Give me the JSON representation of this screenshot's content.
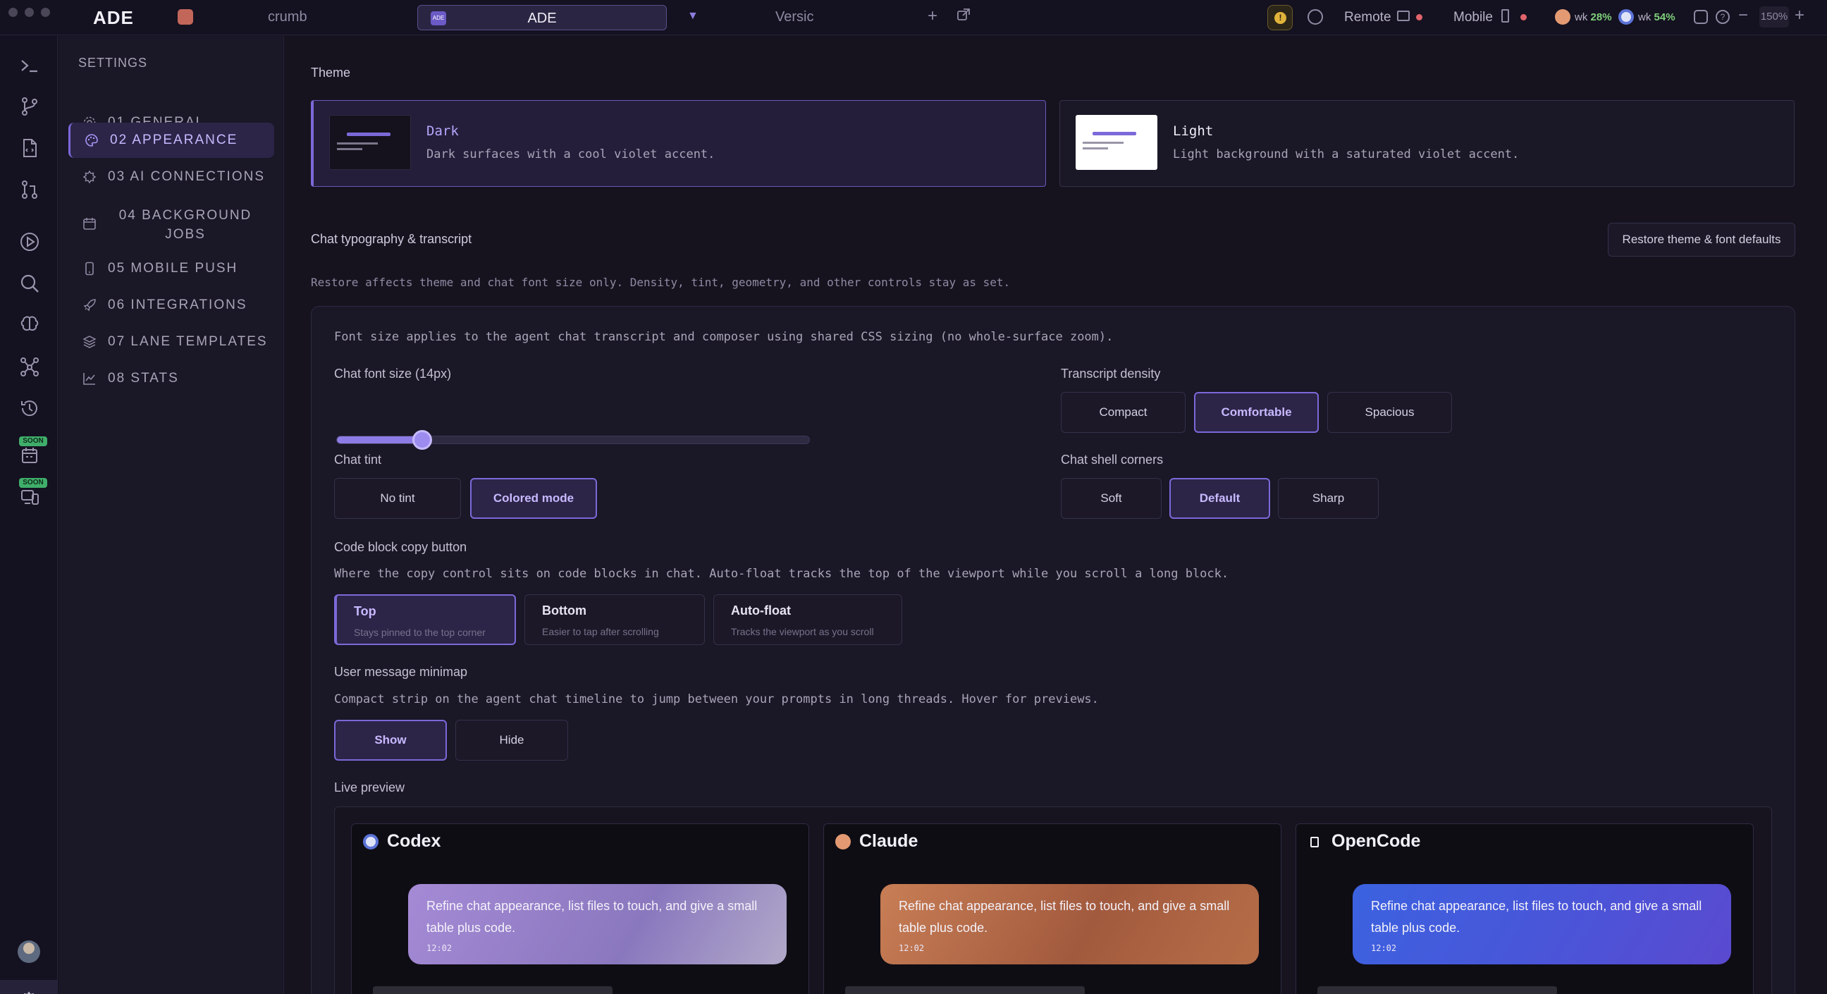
{
  "titlebar": {
    "brand": "ADE",
    "tabs": [
      {
        "label": "crumb"
      },
      {
        "label": "ADE",
        "icon_text": "ADE",
        "active": true
      },
      {
        "label": "Versic"
      }
    ],
    "new_tab": "+",
    "remote_label": "Remote",
    "mobile_label": "Mobile",
    "usage": [
      {
        "prefix": "wk",
        "value": "28%"
      },
      {
        "prefix": "wk",
        "value": "54%"
      }
    ],
    "zoom_minus": "−",
    "zoom": "150%",
    "zoom_plus": "+"
  },
  "rail": {
    "icons": [
      "terminal-icon",
      "branch-icon",
      "files-icon",
      "pull-request-icon",
      "run-icon",
      "search-icon",
      "brain-icon",
      "graph-icon",
      "history-icon",
      "calendar-icon",
      "devices-icon"
    ],
    "soon_badge": "SOON"
  },
  "nav": {
    "heading": "SETTINGS",
    "items": [
      {
        "label": "01 GENERAL",
        "icon": "gear-icon"
      },
      {
        "label": "02 APPEARANCE",
        "icon": "palette-icon",
        "active": true
      },
      {
        "label": "03 AI CONNECTIONS",
        "icon": "ai-icon"
      },
      {
        "label": "04 BACKGROUND JOBS",
        "icon": "calendar-icon"
      },
      {
        "label": "05 MOBILE PUSH",
        "icon": "phone-icon"
      },
      {
        "label": "06 INTEGRATIONS",
        "icon": "rocket-icon"
      },
      {
        "label": "07 LANE TEMPLATES",
        "icon": "layers-icon"
      },
      {
        "label": "08 STATS",
        "icon": "chart-icon"
      }
    ]
  },
  "theme": {
    "title": "Theme",
    "options": [
      {
        "name": "Dark",
        "desc": "Dark surfaces with a cool violet accent.",
        "selected": true
      },
      {
        "name": "Light",
        "desc": "Light background with a saturated violet accent.",
        "selected": false
      }
    ]
  },
  "typography": {
    "title": "Chat typography & transcript",
    "restore_button": "Restore theme & font defaults",
    "restore_note": "Restore affects theme and chat font size only. Density, tint, geometry, and other controls stay as set.",
    "font_note": "Font size applies to the agent chat transcript and composer using shared CSS sizing (no whole-surface zoom).",
    "font_size_label": "Chat font size (14px)",
    "font_size_fraction": 0.18,
    "density": {
      "label": "Transcript density",
      "options": [
        "Compact",
        "Comfortable",
        "Spacious"
      ],
      "selected": "Comfortable"
    },
    "tint": {
      "label": "Chat tint",
      "options": [
        "No tint",
        "Colored mode"
      ],
      "selected": "Colored mode"
    },
    "corners": {
      "label": "Chat shell corners",
      "options": [
        "Soft",
        "Default",
        "Sharp"
      ],
      "selected": "Default"
    },
    "copy_button": {
      "label": "Code block copy button",
      "desc": "Where the copy control sits on code blocks in chat. Auto-float tracks the top of the viewport while you scroll a long block.",
      "options": [
        {
          "title": "Top",
          "sub": "Stays pinned to the top corner"
        },
        {
          "title": "Bottom",
          "sub": "Easier to tap after scrolling"
        },
        {
          "title": "Auto-float",
          "sub": "Tracks the viewport as you scroll"
        }
      ],
      "selected": "Top"
    },
    "minimap": {
      "label": "User message minimap",
      "desc": "Compact strip on the agent chat timeline to jump between your prompts in long threads. Hover for previews.",
      "options": [
        "Show",
        "Hide"
      ],
      "selected": "Show"
    },
    "preview": {
      "label": "Live preview",
      "cards": [
        {
          "name": "Codex",
          "message": "Refine chat appearance, list files to touch, and give a small table plus code.",
          "time": "12:02"
        },
        {
          "name": "Claude",
          "message": "Refine chat appearance, list files to touch, and give a small table plus code.",
          "time": "12:02"
        },
        {
          "name": "OpenCode",
          "message": "Refine chat appearance, list files to touch, and give a small table plus code.",
          "time": "12:02"
        }
      ]
    }
  },
  "colors": {
    "accent": "#7c69d9",
    "accent_light": "#c8b9ff",
    "warning": "#e0b43a",
    "usage_ok": "#7ed07a",
    "soon": "#3fae6a"
  }
}
